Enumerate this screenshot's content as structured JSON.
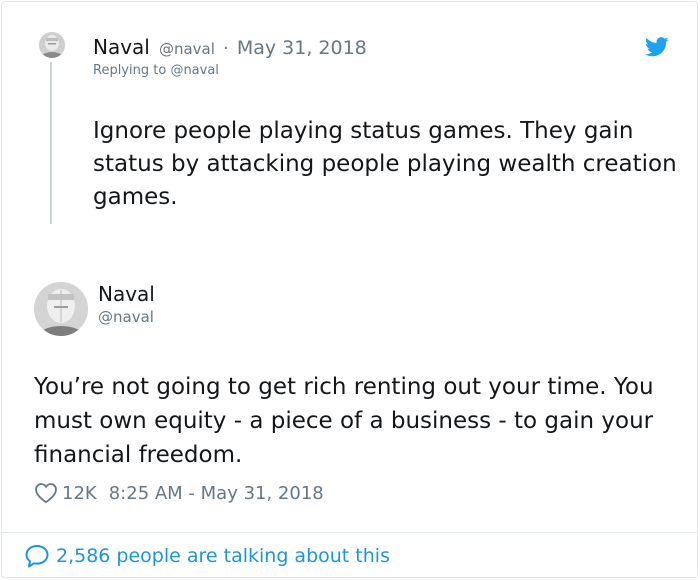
{
  "parent_tweet": {
    "name": "Naval",
    "handle": "@naval",
    "separator": "·",
    "date": "May 31, 2018",
    "replying_prefix": "Replying to",
    "replying_handle": "@naval",
    "text": "Ignore people playing status games. They gain status by attacking people playing wealth creation games."
  },
  "main_tweet": {
    "name": "Naval",
    "handle": "@naval",
    "text": "You’re not going to get rich renting out your time. You must own equity - a piece of a business - to gain your financial freedom.",
    "likes": "12K",
    "timestamp": "8:25 AM - May 31, 2018"
  },
  "footer": {
    "talking_text": "2,586 people are talking about this"
  },
  "icons": {
    "brand": "twitter-bird-icon",
    "like": "heart-icon",
    "reply": "speech-bubble-icon"
  },
  "colors": {
    "twitter_blue": "#1da1f2",
    "link_blue": "#1b95e0",
    "muted_gray": "#657786",
    "text": "#14171a",
    "border": "#e1e8ed"
  }
}
